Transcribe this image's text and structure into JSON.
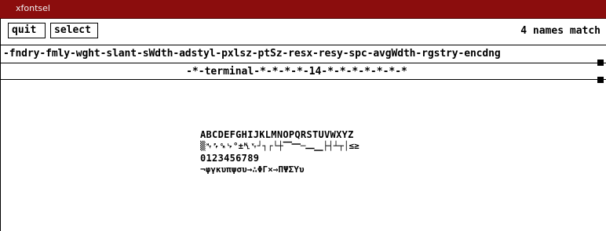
{
  "window": {
    "title": "xfontsel"
  },
  "toolbar": {
    "quit_label": "quit",
    "select_label": "select",
    "match_count": "4 names match"
  },
  "pattern": {
    "field_names": "-fndry-fmly-wght-slant-sWdth-adstyl-pxlsz-ptSz-resx-resy-spc-avgWdth-rgstry-encdng",
    "current_pattern": "-*-terminal-*-*-*-*-14-*-*-*-*-*-*-*"
  },
  "sample": {
    "lines": [
      "ABCDEFGHIJKLMNOPQRSTUVWXYZ",
      "▒␉␌␍␊°±␤␋┘┐┌└┼⎺⎻─⎼⎽├┤┴┬│≤≥",
      "0123456789",
      "¬φγκυπψσυ→∴ΦΓ×⇒ΠΨΣΥυ"
    ]
  }
}
